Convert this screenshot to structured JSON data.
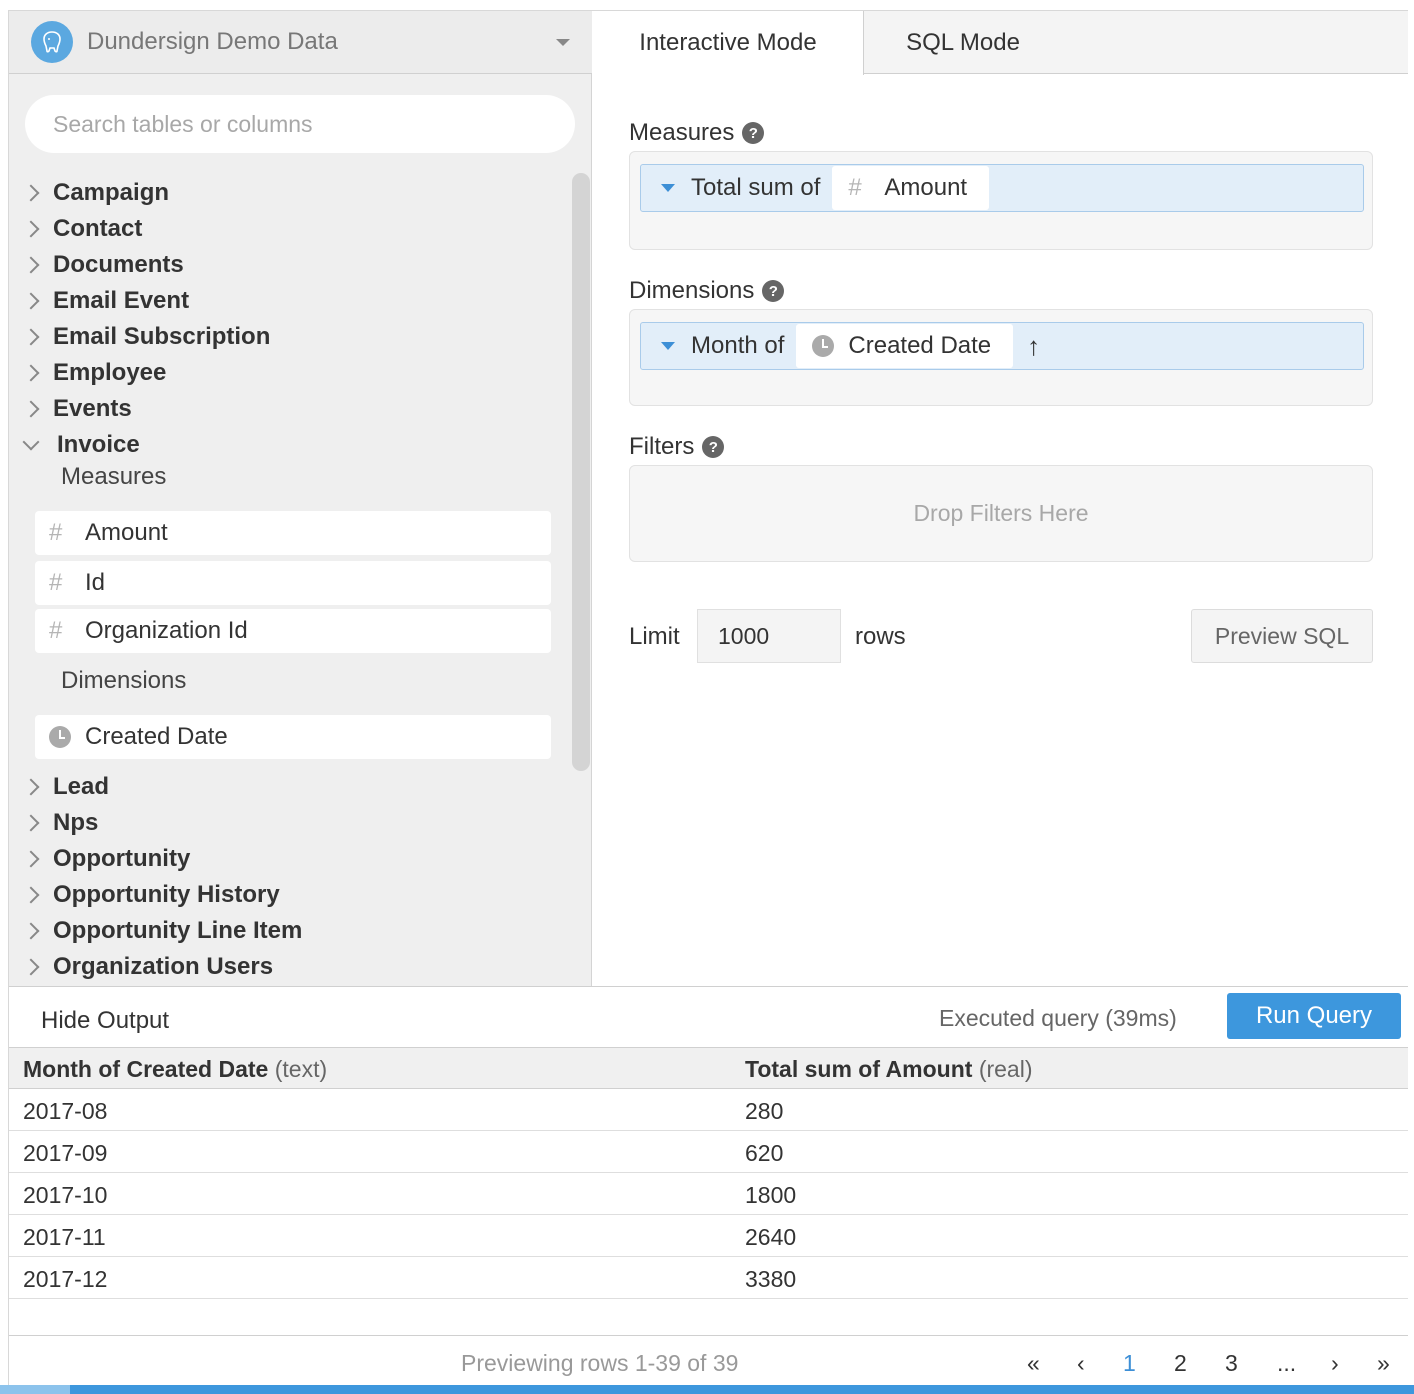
{
  "sidebar": {
    "database_name": "Dundersign Demo Data",
    "search_placeholder": "Search tables or columns",
    "tables_before": [
      "Campaign",
      "Contact",
      "Documents",
      "Email Event",
      "Email Subscription",
      "Employee",
      "Events"
    ],
    "expanded_table": {
      "name": "Invoice",
      "measures_heading": "Measures",
      "measures": [
        "Amount",
        "Id",
        "Organization Id"
      ],
      "dimensions_heading": "Dimensions",
      "dimensions": [
        "Created Date"
      ]
    },
    "tables_after": [
      "Lead",
      "Nps",
      "Opportunity",
      "Opportunity History",
      "Opportunity Line Item",
      "Organization Users"
    ]
  },
  "tabs": [
    "Interactive Mode",
    "SQL Mode"
  ],
  "builder": {
    "measures_label": "Measures",
    "measure_agg": "Total sum of",
    "measure_field": "Amount",
    "dimensions_label": "Dimensions",
    "dimension_agg": "Month of",
    "dimension_field": "Created Date",
    "sort_arrow": "↑",
    "filters_label": "Filters",
    "filters_placeholder": "Drop Filters Here",
    "limit_label": "Limit",
    "limit_value": "1000",
    "rows_label": "rows",
    "preview_sql": "Preview SQL"
  },
  "output": {
    "hide_output": "Hide Output",
    "status": "Executed query (39ms)",
    "run_query": "Run Query",
    "columns": [
      {
        "name": "Month of Created Date",
        "type": "(text)"
      },
      {
        "name": "Total sum of Amount",
        "type": "(real)"
      }
    ],
    "rows": [
      [
        "2017-08",
        "280"
      ],
      [
        "2017-09",
        "620"
      ],
      [
        "2017-10",
        "1800"
      ],
      [
        "2017-11",
        "2640"
      ],
      [
        "2017-12",
        "3380"
      ]
    ],
    "preview_text": "Previewing rows 1-39 of 39",
    "pager": {
      "first": "«",
      "prev": "‹",
      "pages": [
        "1",
        "2",
        "3"
      ],
      "ellipsis": "...",
      "next": "›",
      "last": "»",
      "current": "1"
    }
  },
  "colors": {
    "accent": "#3d97dd",
    "pill_bg": "#e2eef9",
    "sidebar_bg": "#efefef"
  },
  "icons": {
    "db_logo": "postgres-elephant-icon",
    "measure": "hash-icon",
    "dimension": "clock-icon",
    "help": "question-circle-icon",
    "expand": "chevron-right-icon"
  }
}
